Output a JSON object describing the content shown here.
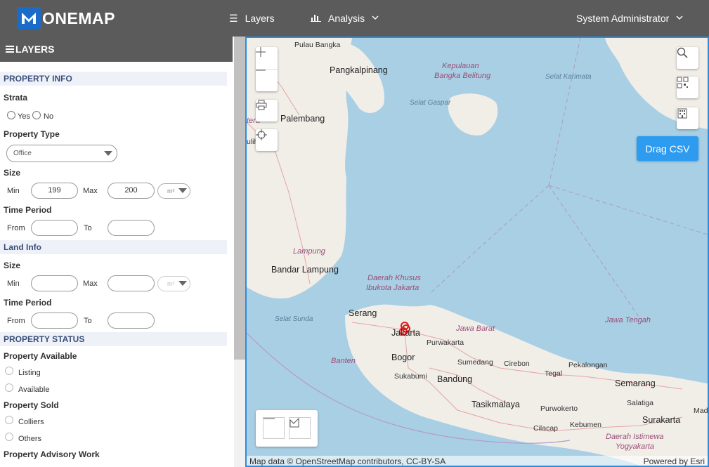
{
  "header": {
    "logo_text": "ONEMAP",
    "nav": [
      {
        "label": "Layers",
        "icon": "list-icon"
      },
      {
        "label": "Analysis",
        "icon": "bar-chart-icon"
      }
    ],
    "user": "System Administrator"
  },
  "sidebar": {
    "title": "LAYERS",
    "property_info": {
      "section": "PROPERTY INFO",
      "strata_label": "Strata",
      "strata_yes": "Yes",
      "strata_no": "No",
      "property_type_label": "Property Type",
      "property_type_value": "Office",
      "size_label": "Size",
      "min_label": "Min",
      "min_value": "199",
      "max_label": "Max",
      "max_value": "200",
      "unit": "m²",
      "time_period_label": "Time Period",
      "from_label": "From",
      "to_label": "To"
    },
    "land_info": {
      "section": "Land Info",
      "size_label": "Size",
      "min_label": "Min",
      "max_label": "Max",
      "unit": "m²",
      "time_period_label": "Time Period",
      "from_label": "From",
      "to_label": "To"
    },
    "property_status": {
      "section": "PROPERTY STATUS",
      "available_label": "Property Available",
      "available_options": [
        "Listing",
        "Available"
      ],
      "sold_label": "Property Sold",
      "sold_options": [
        "Colliers",
        "Others"
      ],
      "advisory_label": "Property Advisory Work"
    }
  },
  "map": {
    "drag_csv": "Drag CSV",
    "attribution": "Map data © OpenStreetMap contributors, CC-BY-SA",
    "powered_by": "Powered by Esri",
    "labels": {
      "pulau_bangka": "Pulau Bangka",
      "pangkalpinang": "Pangkalpinang",
      "kepulauan": "Kepulauan",
      "bangka_belitung": "Bangka Belitung",
      "selat_karimata": "Selat Karimata",
      "selat_gaspar": "Selat Gaspar",
      "palembang": "Palembang",
      "lampung": "Lampung",
      "bandar_lampung": "Bandar Lampung",
      "daerah_khusus": "Daerah Khusus",
      "ibukota_jakarta": "Ibukota Jakarta",
      "serang": "Serang",
      "selat_sunda": "Selat Sunda",
      "jakarta": "Jakarta",
      "jawa_barat": "Jawa Barat",
      "jawa_tengah": "Jawa Tengah",
      "purwakarta": "Purwakarta",
      "bogor": "Bogor",
      "banten": "Banten",
      "sumedang": "Sumedang",
      "cirebon": "Cirebon",
      "pekalongan": "Pekalongan",
      "tegal": "Tegal",
      "semarang": "Semarang",
      "sukabumi": "Sukabumi",
      "bandung": "Bandung",
      "tasikmalaya": "Tasikmalaya",
      "purwokerto": "Purwokerto",
      "salatiga": "Salatiga",
      "cilacap": "Cilacap",
      "kebumen": "Kebumen",
      "surakarta": "Surakarta",
      "daerah_istimewa": "Daerah Istimewa",
      "yogyakarta": "Yogyakarta",
      "mad": "Mad",
      "tera": "tera",
      "ulih": "ulih"
    }
  }
}
